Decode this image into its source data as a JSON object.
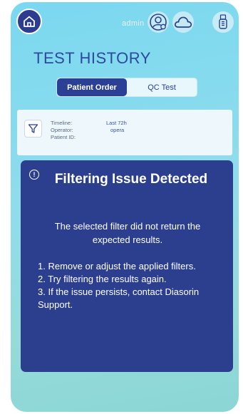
{
  "header": {
    "user_label": "admin",
    "home_icon": "home-icon",
    "user_icon": "user-settings-icon",
    "cloud_icon": "cloud-icon",
    "usb_icon": "usb-drive-icon"
  },
  "page": {
    "title": "TEST HISTORY"
  },
  "tabs": [
    {
      "label": "Patient Order",
      "active": true
    },
    {
      "label": "QC Test",
      "active": false
    }
  ],
  "filters": {
    "icon": "filter-icon",
    "rows": [
      {
        "label": "Timeline:",
        "value": "Last 72h"
      },
      {
        "label": "Operator:",
        "value": "opera"
      },
      {
        "label": "Patient ID:",
        "value": ""
      }
    ]
  },
  "dialog": {
    "icon": "alert-circle-icon",
    "title": "Filtering Issue Detected",
    "message": "The selected filter did not return the expected results.",
    "steps": [
      "1. Remove or adjust the applied filters.",
      "2. Try filtering the results again.",
      "3. If the issue persists, contact Diasorin Support."
    ]
  },
  "colors": {
    "primary": "#2c3f8f",
    "background_top": "#7ad8f0",
    "background_bottom": "#8bd6d6",
    "panel": "#eef7fb"
  }
}
